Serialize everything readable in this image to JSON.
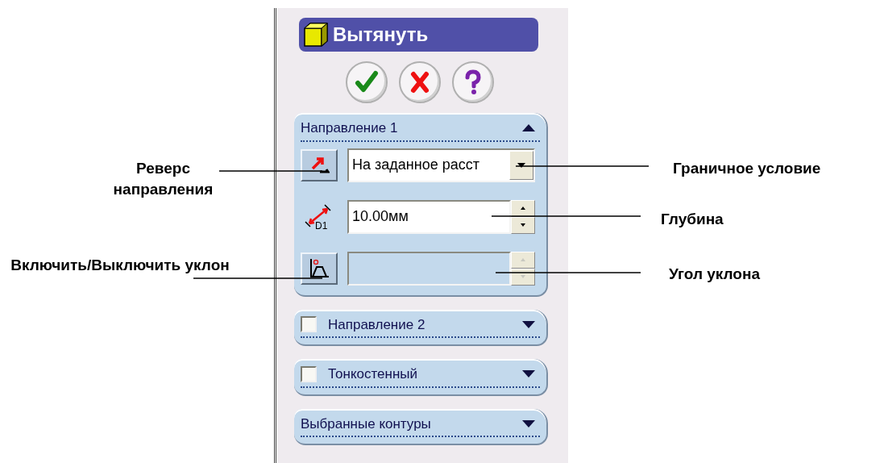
{
  "panel": {
    "title": "Вытянуть",
    "action_buttons": [
      {
        "kind": "ok"
      },
      {
        "kind": "cancel"
      },
      {
        "kind": "help"
      }
    ],
    "groups": [
      {
        "title": "Направление 1",
        "expanded": true,
        "rows": [
          {
            "kind": "direction",
            "value": "На заданное расст"
          },
          {
            "kind": "depth",
            "label": "D1",
            "value": "10.00мм",
            "disabled": false
          },
          {
            "kind": "draft",
            "disabled": true
          }
        ]
      },
      {
        "title": "Направление 2",
        "expanded": false,
        "checked": false
      },
      {
        "title": "Тонкостенный",
        "expanded": false,
        "checked": false
      },
      {
        "title": "Выбранные контуры",
        "expanded": false
      }
    ]
  },
  "callouts": [
    {
      "text": "Реверс направления"
    },
    {
      "text": "Включить/Выключить уклон"
    },
    {
      "text": "Граничное условие"
    },
    {
      "text": "Глубина"
    },
    {
      "text": "Угол уклона"
    }
  ]
}
